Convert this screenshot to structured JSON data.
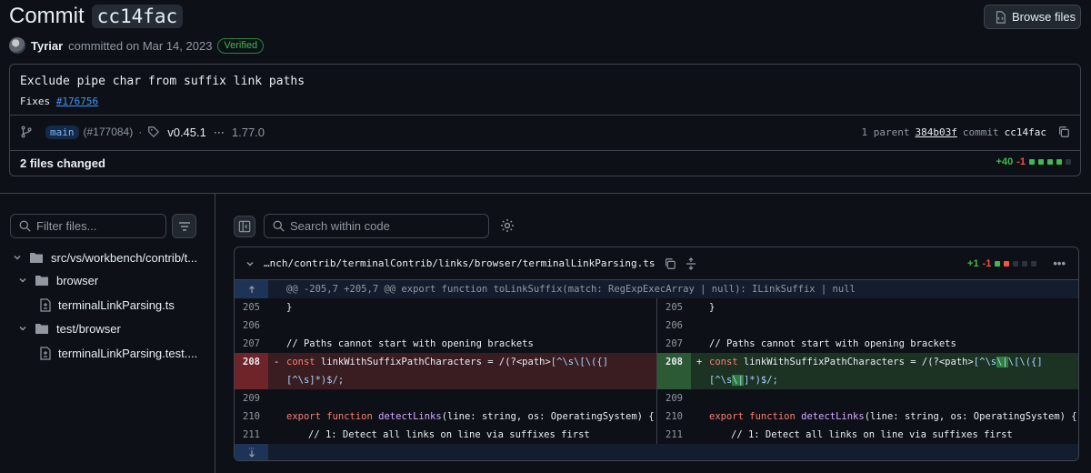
{
  "header": {
    "title_prefix": "Commit",
    "sha_short": "cc14fac",
    "browse_label": "Browse files",
    "author": "Tyriar",
    "committed_on": "committed on Mar 14, 2023",
    "verified": "Verified"
  },
  "commit": {
    "message": "Exclude pipe char from suffix link paths",
    "fixes_label": "Fixes",
    "fixes_link": "#176756",
    "branch": "main",
    "pr": "(#177084)",
    "dot": "·",
    "tag": "v0.45.1",
    "ellipsis": "···",
    "tag2": "1.77.0",
    "parent_label": "1 parent",
    "parent_sha": "384b03f",
    "commit_label": "commit",
    "commit_sha": "cc14fac",
    "files_changed": "2 files changed",
    "additions": "+40",
    "deletions": "-1"
  },
  "sidebar": {
    "filter_placeholder": "Filter files...",
    "tree": [
      {
        "label": "src/vs/workbench/contrib/t...",
        "type": "folder"
      },
      {
        "label": "browser",
        "type": "folder"
      },
      {
        "label": "terminalLinkParsing.ts",
        "type": "file"
      },
      {
        "label": "test/browser",
        "type": "folder"
      },
      {
        "label": "terminalLinkParsing.test....",
        "type": "file"
      }
    ]
  },
  "diff": {
    "search_placeholder": "Search within code",
    "file_path": "…nch/contrib/terminalContrib/links/browser/terminalLinkParsing.ts",
    "file_additions": "+1",
    "file_deletions": "-1",
    "hunk_header": "@@ -205,7 +205,7 @@ export function toLinkSuffix(match: RegExpExecArray | null): ILinkSuffix | null",
    "line_numbers": [
      "205",
      "206",
      "207",
      "208",
      "209",
      "210",
      "211"
    ],
    "code": {
      "brace": "}",
      "comment1": "// Paths cannot start with opening brackets",
      "const_kw": "const",
      "var_name": " linkWithSuffixPathCharacters = /(?<path>",
      "old_rest1": "[^\\s\\[\\({]",
      "old_rest2": "[^\\s]*)$/;",
      "new_rest1a": "[^\\s",
      "new_hl1": "\\|",
      "new_rest1b": "\\[\\({]",
      "new_rest2a": "[^\\s",
      "new_hl2": "\\|",
      "new_rest2b": "]*)$/;",
      "minus": "-",
      "plus": "+",
      "export_kw": "export function",
      "fn_name": "detectLinks",
      "fn_args": "(line: string, os: OperatingSystem) {",
      "comment2": "// 1: Detect all links on line via suffixes first"
    }
  },
  "colors": {
    "background": "#0d1117",
    "border": "#3d444d",
    "addition": "#3fb950",
    "deletion": "#f85149",
    "link": "#4493f8"
  }
}
